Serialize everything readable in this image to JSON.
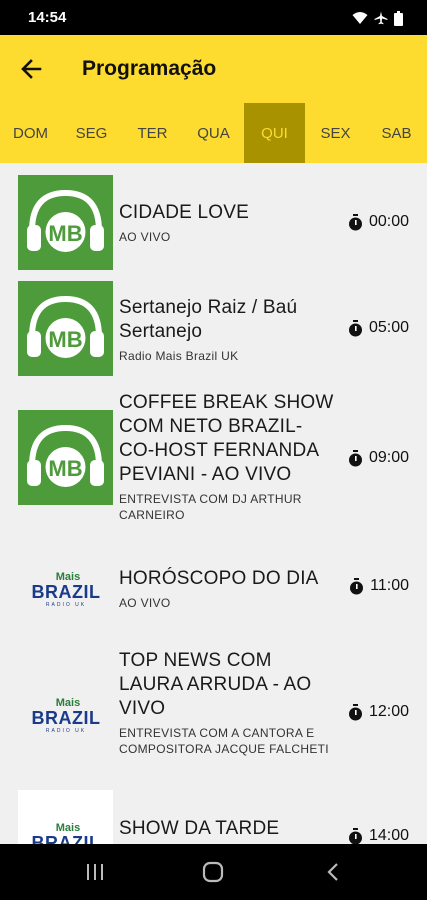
{
  "status_bar": {
    "time": "14:54"
  },
  "app_bar": {
    "title": "Programação"
  },
  "tabs": [
    {
      "label": "DOM"
    },
    {
      "label": "SEG"
    },
    {
      "label": "TER"
    },
    {
      "label": "QUA"
    },
    {
      "label": "QUI",
      "active": true
    },
    {
      "label": "SEX"
    },
    {
      "label": "SAB"
    }
  ],
  "logo_text": {
    "mb": "MB",
    "mais": "Mais",
    "brazil": "BRAZIL",
    "radio_uk": "RADIO UK"
  },
  "programs": [
    {
      "title": "CIDADE LOVE",
      "subtitle": "AO VIVO",
      "time": "00:00",
      "logo": "mb"
    },
    {
      "title": "Sertanejo Raiz  / Baú Sertanejo",
      "subtitle": "Radio Mais Brazil UK",
      "time": "05:00",
      "logo": "mb"
    },
    {
      "title": "COFFEE BREAK SHOW COM NETO BRAZIL- CO-HOST FERNANDA PEVIANI  - AO VIVO",
      "subtitle": "ENTREVISTA COM  DJ ARTHUR CARNEIRO",
      "time": "09:00",
      "logo": "mb"
    },
    {
      "title": "HORÓSCOPO DO DIA",
      "subtitle": "AO VIVO",
      "time": "11:00",
      "logo": "mais-brazil"
    },
    {
      "title": "TOP NEWS COM LAURA ARRUDA - AO VIVO",
      "subtitle": "ENTREVISTA COM A CANTORA E COMPOSITORA JACQUE FALCHETI",
      "time": "12:00",
      "logo": "mais-brazil"
    },
    {
      "title": "SHOW DA TARDE",
      "subtitle": "",
      "time": "14:00",
      "logo": "mais-brazil"
    }
  ],
  "colors": {
    "accent": "#fddc2f",
    "active_tab": "#a89200",
    "logo_green": "#4e9b3c"
  }
}
